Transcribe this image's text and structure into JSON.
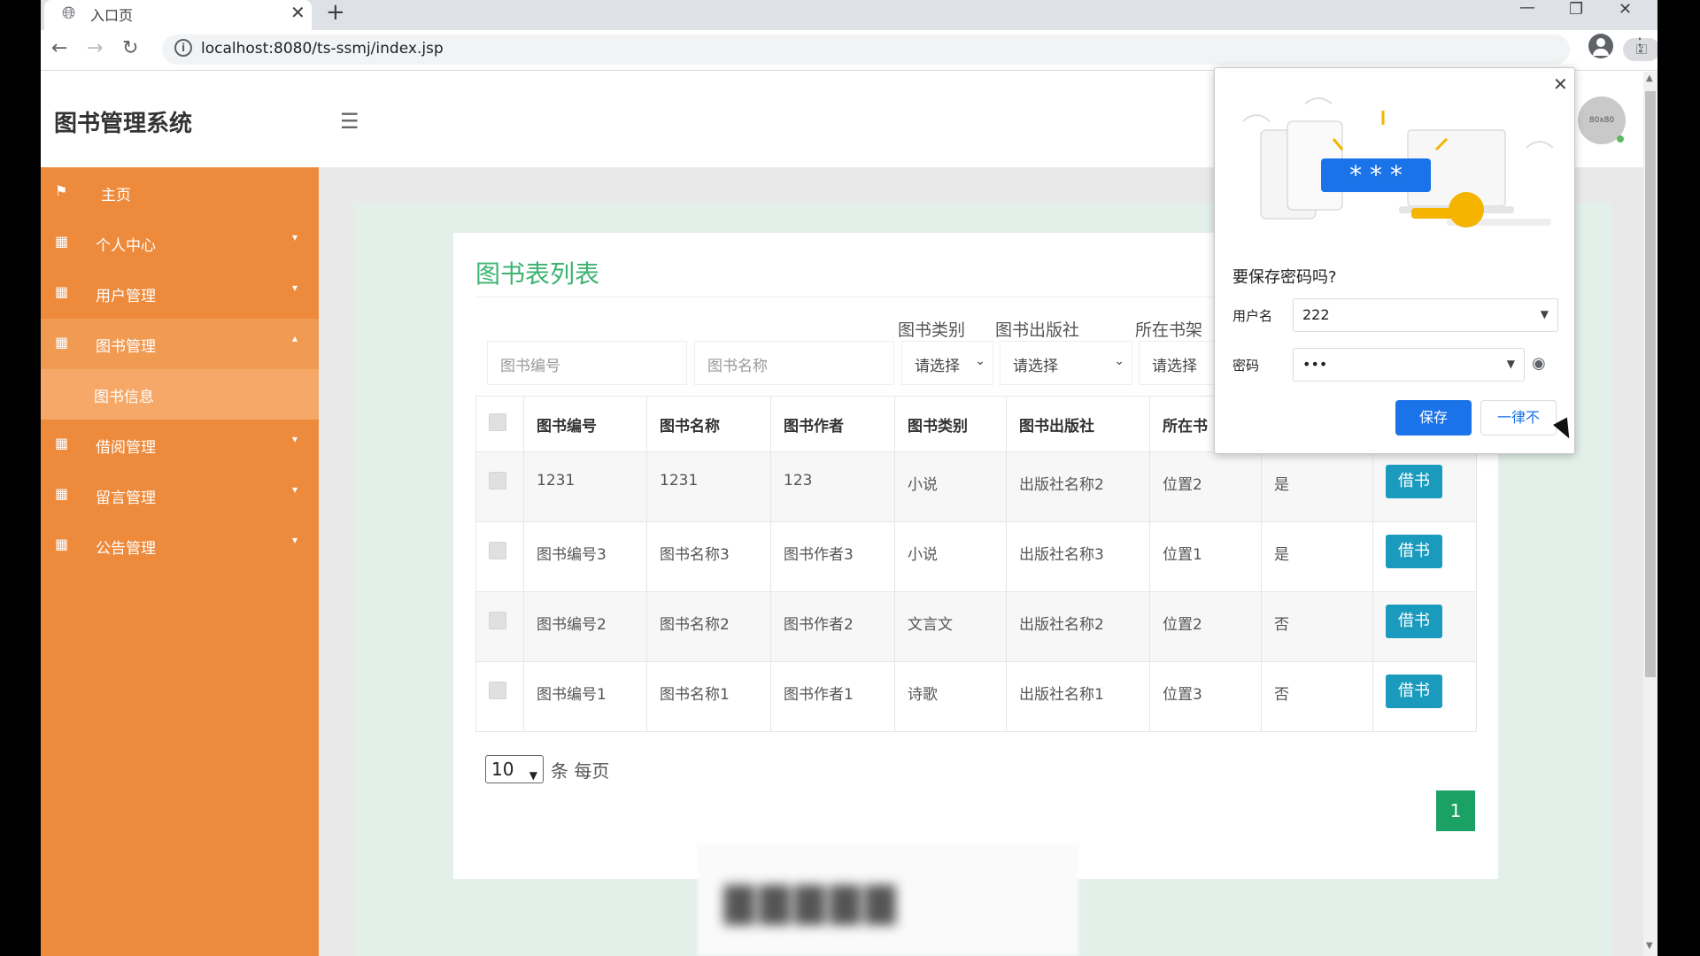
{
  "browser": {
    "tab_title": "入口页",
    "url": "localhost:8080/ts-ssmj/index.jsp"
  },
  "header": {
    "app_title": "图书管理系统",
    "avatar_text": "80x80"
  },
  "sidebar": {
    "items": [
      {
        "label": "主页",
        "icon": "flag-icon"
      },
      {
        "label": "个人中心",
        "icon": "grid-icon"
      },
      {
        "label": "用户管理",
        "icon": "grid-icon"
      },
      {
        "label": "图书管理",
        "icon": "grid-icon"
      },
      {
        "label": "借阅管理",
        "icon": "grid-icon"
      },
      {
        "label": "留言管理",
        "icon": "grid-icon"
      },
      {
        "label": "公告管理",
        "icon": "grid-icon"
      }
    ],
    "sub_item": "图书信息"
  },
  "main": {
    "card_title": "图书表列表",
    "filters": {
      "book_no_placeholder": "图书编号",
      "book_name_placeholder": "图书名称",
      "category_label": "图书类别",
      "category_value": "请选择",
      "publisher_label": "图书出版社",
      "publisher_value": "请选择",
      "shelf_label": "所在书架",
      "shelf_value": "请选择"
    },
    "table": {
      "headers": [
        "图书编号",
        "图书名称",
        "图书作者",
        "图书类别",
        "图书出版社",
        "所在书"
      ],
      "rows": [
        {
          "no": "1231",
          "name": "1231",
          "author": "123",
          "category": "小说",
          "publisher": "出版社名称2",
          "shelf": "位置2",
          "available": "是",
          "action": "借书"
        },
        {
          "no": "图书编号3",
          "name": "图书名称3",
          "author": "图书作者3",
          "category": "小说",
          "publisher": "出版社名称3",
          "shelf": "位置1",
          "available": "是",
          "action": "借书"
        },
        {
          "no": "图书编号2",
          "name": "图书名称2",
          "author": "图书作者2",
          "category": "文言文",
          "publisher": "出版社名称2",
          "shelf": "位置2",
          "available": "否",
          "action": "借书"
        },
        {
          "no": "图书编号1",
          "name": "图书名称1",
          "author": "图书作者1",
          "category": "诗歌",
          "publisher": "出版社名称1",
          "shelf": "位置3",
          "available": "否",
          "action": "借书"
        }
      ]
    },
    "pagination": {
      "page_size": "10",
      "page_size_label": "条 每页",
      "current_page": "1"
    }
  },
  "password_popup": {
    "title": "要保存密码吗?",
    "username_label": "用户名",
    "username_value": "222",
    "password_label": "密码",
    "password_value": "•••",
    "save_label": "保存",
    "never_label": "一律不",
    "illustration_text": "* * *"
  },
  "colors": {
    "sidebar": "#ed8a3c",
    "title_green": "#3cb371",
    "borrow_button": "#1a9bbd",
    "page_button": "#1aa163",
    "save_button": "#1a73e8"
  }
}
